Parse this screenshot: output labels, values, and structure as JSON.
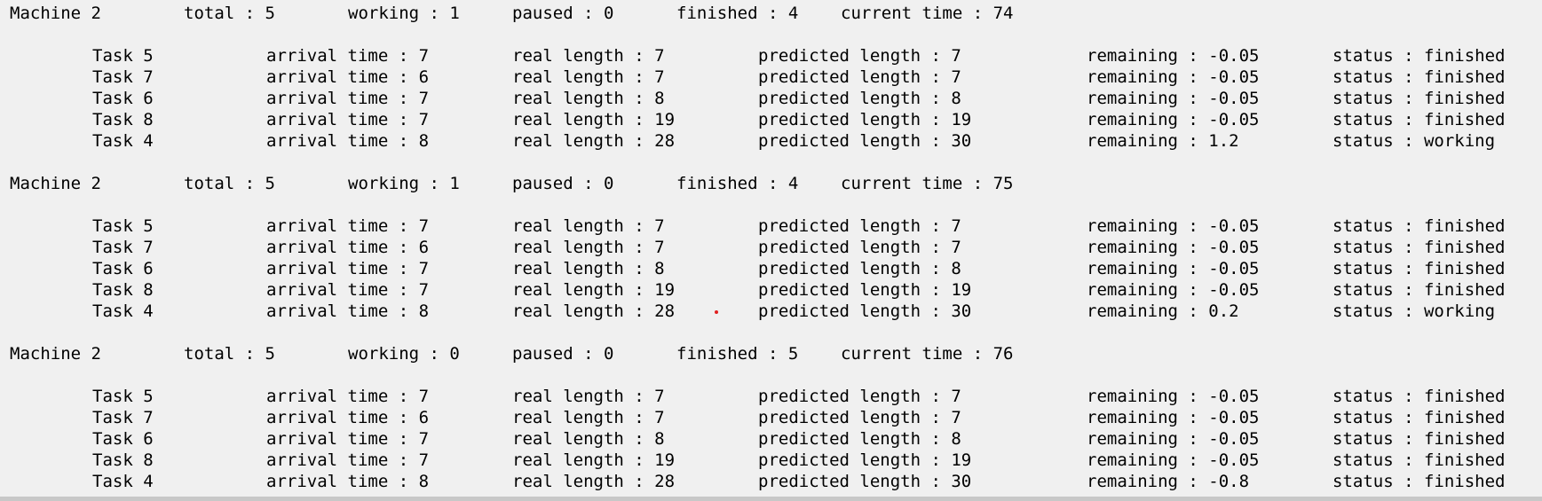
{
  "snapshots": [
    {
      "header": {
        "machine": "Machine 2",
        "total": "total : 5",
        "working": "working : 1",
        "paused": "paused : 0",
        "finished": "finished : 4",
        "current_time": "current time : 74"
      },
      "tasks": [
        {
          "name": "Task 5",
          "arrival": "arrival time : 7",
          "real": "real length : 7",
          "predicted": "predicted length : 7",
          "remaining": "remaining : -0.05",
          "status": "status : finished"
        },
        {
          "name": "Task 7",
          "arrival": "arrival time : 6",
          "real": "real length : 7",
          "predicted": "predicted length : 7",
          "remaining": "remaining : -0.05",
          "status": "status : finished"
        },
        {
          "name": "Task 6",
          "arrival": "arrival time : 7",
          "real": "real length : 8",
          "predicted": "predicted length : 8",
          "remaining": "remaining : -0.05",
          "status": "status : finished"
        },
        {
          "name": "Task 8",
          "arrival": "arrival time : 7",
          "real": "real length : 19",
          "predicted": "predicted length : 19",
          "remaining": "remaining : -0.05",
          "status": "status : finished"
        },
        {
          "name": "Task 4",
          "arrival": "arrival time : 8",
          "real": "real length : 28",
          "predicted": "predicted length : 30",
          "remaining": "remaining : 1.2",
          "status": "status : working"
        }
      ]
    },
    {
      "header": {
        "machine": "Machine 2",
        "total": "total : 5",
        "working": "working : 1",
        "paused": "paused : 0",
        "finished": "finished : 4",
        "current_time": "current time : 75"
      },
      "tasks": [
        {
          "name": "Task 5",
          "arrival": "arrival time : 7",
          "real": "real length : 7",
          "predicted": "predicted length : 7",
          "remaining": "remaining : -0.05",
          "status": "status : finished"
        },
        {
          "name": "Task 7",
          "arrival": "arrival time : 6",
          "real": "real length : 7",
          "predicted": "predicted length : 7",
          "remaining": "remaining : -0.05",
          "status": "status : finished"
        },
        {
          "name": "Task 6",
          "arrival": "arrival time : 7",
          "real": "real length : 8",
          "predicted": "predicted length : 8",
          "remaining": "remaining : -0.05",
          "status": "status : finished"
        },
        {
          "name": "Task 8",
          "arrival": "arrival time : 7",
          "real": "real length : 19",
          "predicted": "predicted length : 19",
          "remaining": "remaining : -0.05",
          "status": "status : finished"
        },
        {
          "name": "Task 4",
          "arrival": "arrival time : 8",
          "real": "real length : 28",
          "predicted": "predicted length : 30",
          "remaining": "remaining : 0.2",
          "status": "status : working"
        }
      ]
    },
    {
      "header": {
        "machine": "Machine 2",
        "total": "total : 5",
        "working": "working : 0",
        "paused": "paused : 0",
        "finished": "finished : 5",
        "current_time": "current time : 76"
      },
      "tasks": [
        {
          "name": "Task 5",
          "arrival": "arrival time : 7",
          "real": "real length : 7",
          "predicted": "predicted length : 7",
          "remaining": "remaining : -0.05",
          "status": "status : finished"
        },
        {
          "name": "Task 7",
          "arrival": "arrival time : 6",
          "real": "real length : 7",
          "predicted": "predicted length : 7",
          "remaining": "remaining : -0.05",
          "status": "status : finished"
        },
        {
          "name": "Task 6",
          "arrival": "arrival time : 7",
          "real": "real length : 8",
          "predicted": "predicted length : 8",
          "remaining": "remaining : -0.05",
          "status": "status : finished"
        },
        {
          "name": "Task 8",
          "arrival": "arrival time : 7",
          "real": "real length : 19",
          "predicted": "predicted length : 19",
          "remaining": "remaining : -0.05",
          "status": "status : finished"
        },
        {
          "name": "Task 4",
          "arrival": "arrival time : 8",
          "real": "real length : 28",
          "predicted": "predicted length : 30",
          "remaining": "remaining : -0.8",
          "status": "status : finished"
        }
      ]
    }
  ],
  "colors": {
    "background": "#f0f0f0",
    "text": "#000000",
    "cursor_dot": "#e02020"
  }
}
